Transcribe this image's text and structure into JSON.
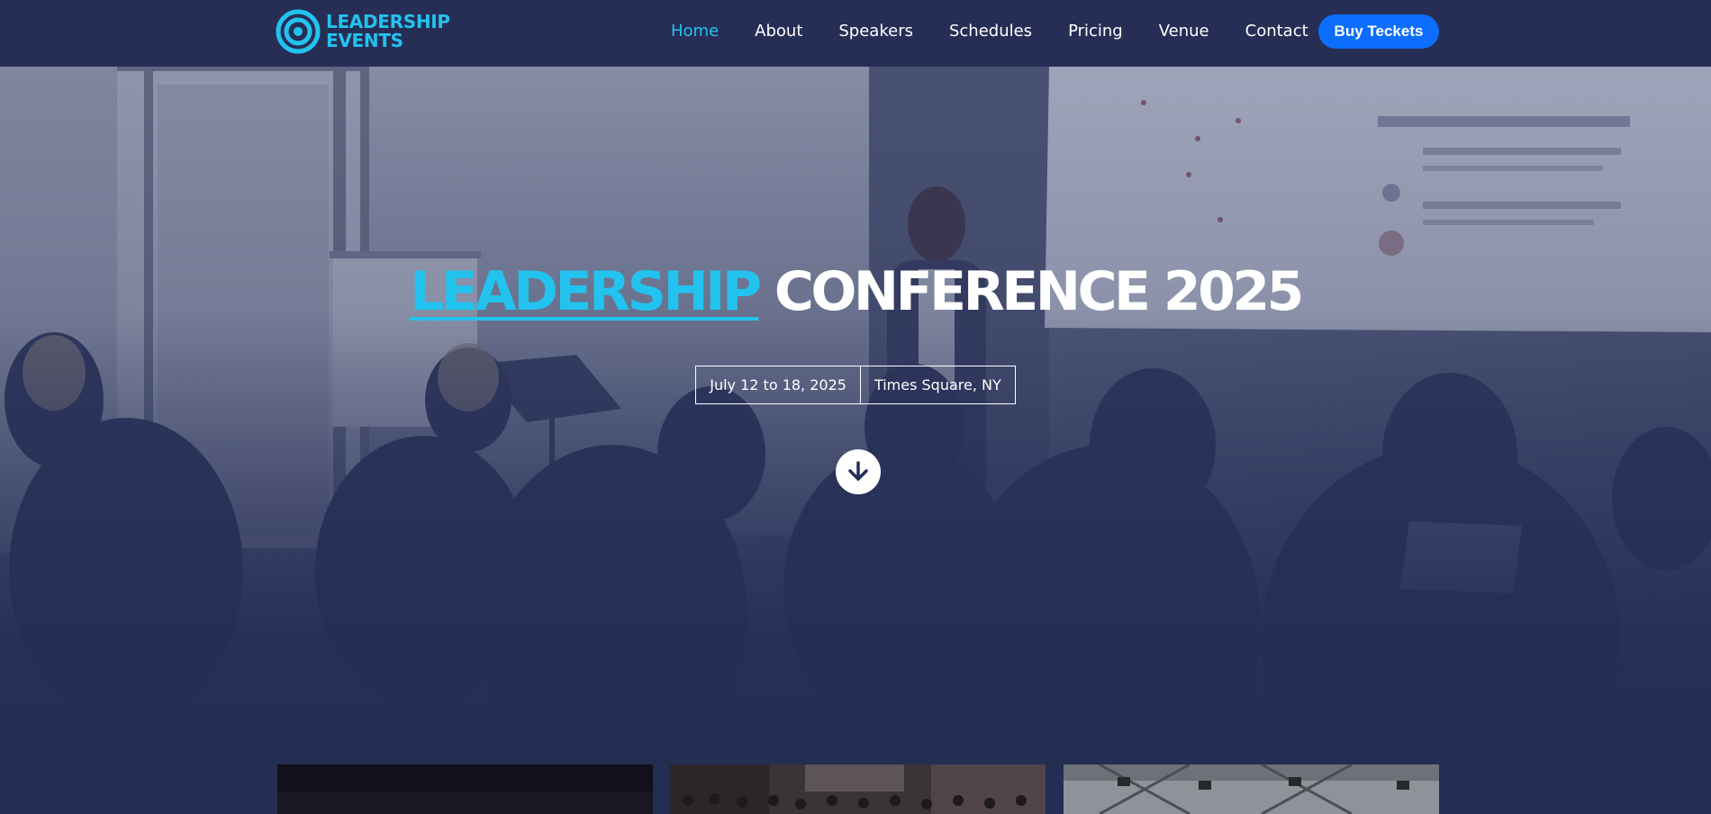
{
  "brand": {
    "line1": "LEADERSHIP",
    "line2": "EVENTS",
    "accent_color": "#22c3ee",
    "icon": "target-icon"
  },
  "nav": {
    "items": [
      {
        "label": "Home",
        "active": true
      },
      {
        "label": "About",
        "active": false
      },
      {
        "label": "Speakers",
        "active": false
      },
      {
        "label": "Schedules",
        "active": false
      },
      {
        "label": "Pricing",
        "active": false
      },
      {
        "label": "Venue",
        "active": false
      },
      {
        "label": "Contact",
        "active": false
      }
    ],
    "cta_label": "Buy Teckets",
    "cta_color": "#0d6efd"
  },
  "hero": {
    "title_accent": "LEADERSHIP",
    "title_rest": " CONFERENCE 2025",
    "dates": "July 12 to 18, 2025",
    "location": "Times Square, NY",
    "scroll_icon": "arrow-down-icon"
  },
  "colors": {
    "nav_bg": "#262e56",
    "page_bg": "#242d52"
  }
}
